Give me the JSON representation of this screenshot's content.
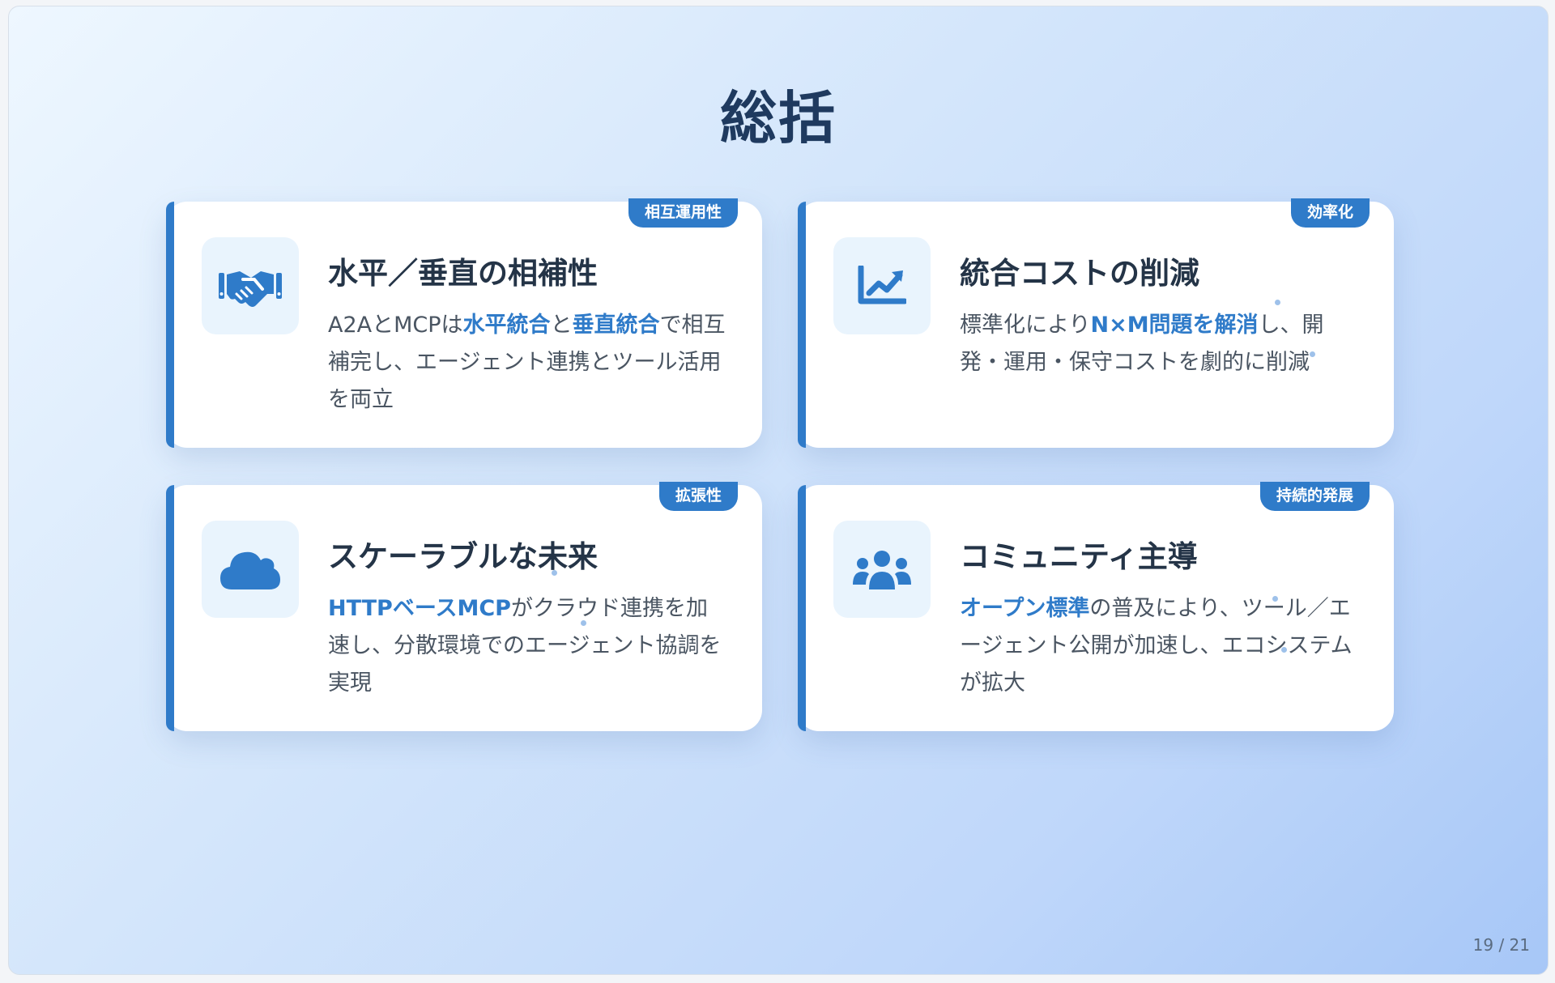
{
  "slide": {
    "title": "総括",
    "page_indicator": "19 / 21"
  },
  "cards": [
    {
      "tag": "相互運用性",
      "icon": "handshake-icon",
      "title": "水平／垂直の相補性",
      "text_segments": [
        {
          "text": "A2AとMCPは",
          "highlight": false
        },
        {
          "text": "水平統合",
          "highlight": true
        },
        {
          "text": "と",
          "highlight": false
        },
        {
          "text": "垂直統合",
          "highlight": true
        },
        {
          "text": "で相互補完し、エージェント連携とツール活用を両立",
          "highlight": false
        }
      ]
    },
    {
      "tag": "効率化",
      "icon": "chart-line-icon",
      "title": "統合コストの削減",
      "text_segments": [
        {
          "text": "標準化により",
          "highlight": false
        },
        {
          "text": "N×M問題を解消",
          "highlight": true
        },
        {
          "text": "し、開発・運用・保守コストを劇的に削減",
          "highlight": false
        }
      ]
    },
    {
      "tag": "拡張性",
      "icon": "cloud-icon",
      "title": "スケーラブルな未来",
      "text_segments": [
        {
          "text": "HTTPベースMCP",
          "highlight": true
        },
        {
          "text": "がクラウド連携を加速し、分散環境でのエージェント協調を実現",
          "highlight": false
        }
      ]
    },
    {
      "tag": "持続的発展",
      "icon": "users-icon",
      "title": "コミュニティ主導",
      "text_segments": [
        {
          "text": "オープン標準",
          "highlight": true
        },
        {
          "text": "の普及により、ツール／エージェント公開が加速し、エコシステムが拡大",
          "highlight": false
        }
      ]
    }
  ],
  "colors": {
    "accent": "#2f7bc9",
    "title": "#1f3a5f",
    "card_title": "#243447",
    "body_text": "#4a5562",
    "icon_bg": "#e9f4fd"
  }
}
